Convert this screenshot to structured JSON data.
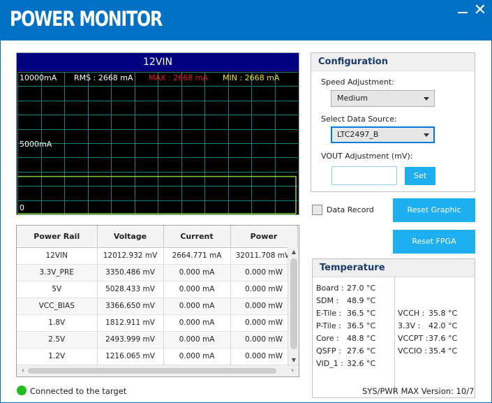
{
  "app": {
    "title": "POWER MONITOR",
    "minimize_icon": "minimize-icon",
    "close_icon": "close-icon",
    "close_glyph": "✕"
  },
  "graph": {
    "rail": "12VIN",
    "y_max_label": "10000mA",
    "y_mid_label": "5000mA",
    "y_min_label": "0",
    "rms": "RMS : 2668 mA",
    "max": "MAX : 2668 mA",
    "min": "MIN : 2668 mA",
    "colors": {
      "header_bg": "#000080",
      "grid": "#1a7f7f",
      "trace": "#7fd13b",
      "max": "#e02020",
      "min": "#f0e020"
    }
  },
  "chart_data": {
    "type": "line",
    "title": "12VIN",
    "ylim": [
      0,
      10000
    ],
    "ytick_labels": [
      "10000mA",
      "5000mA",
      "0"
    ],
    "series": [
      {
        "name": "12VIN",
        "values": [
          2668,
          2668
        ]
      }
    ],
    "stats": {
      "rms_ma": 2668,
      "max_ma": 2668,
      "min_ma": 2668
    },
    "grid": true
  },
  "table": {
    "headers": [
      "Power Rail",
      "Voltage",
      "Current",
      "Power"
    ],
    "rows": [
      [
        "12VIN",
        "12012.932 mV",
        "2664.771 mA",
        "32011.708 mW"
      ],
      [
        "3.3V_PRE",
        "3350.486 mV",
        "0.000 mA",
        "0.000 mW"
      ],
      [
        "5V",
        "5028.433 mV",
        "0.000 mA",
        "0.000 mW"
      ],
      [
        "VCC_BIAS",
        "3366.650 mV",
        "0.000 mA",
        "0.000 mW"
      ],
      [
        "1.8V",
        "1812.911 mV",
        "0.000 mA",
        "0.000 mW"
      ],
      [
        "2.5V",
        "2493.999 mV",
        "0.000 mA",
        "0.000 mW"
      ],
      [
        "1.2V",
        "1216.065 mV",
        "0.000 mA",
        "0.000 mW"
      ]
    ]
  },
  "config": {
    "title": "Configuration",
    "speed_label": "Speed Adjustment:",
    "speed_value": "Medium",
    "source_label": "Select Data Source:",
    "source_value": "LTC2497_B",
    "vout_label": "VOUT Adjustment (mV):",
    "vout_value": "",
    "set_label": "Set"
  },
  "controls": {
    "data_record_label": "Data Record",
    "data_record_checked": false,
    "reset_graphic_label": "Reset Graphic",
    "reset_fpga_label": "Reset FPGA"
  },
  "temperature": {
    "title": "Temperature",
    "left": [
      {
        "name": "Board :",
        "value": "27.0 °C"
      },
      {
        "name": "SDM :",
        "value": "48.9 °C"
      },
      {
        "name": "E-Tile :",
        "value": "36.5 °C"
      },
      {
        "name": "P-Tile :",
        "value": "36.5 °C"
      },
      {
        "name": "Core :",
        "value": "48.8 °C"
      },
      {
        "name": "QSFP :",
        "value": "27.6 °C"
      },
      {
        "name": "VID_1 :",
        "value": "32.6 °C"
      }
    ],
    "right": [
      {
        "name": "VCCH :",
        "value": "35.8 °C"
      },
      {
        "name": "3.3V :",
        "value": "42.0 °C"
      },
      {
        "name": "VCCPT :",
        "value": "37.6 °C"
      },
      {
        "name": "VCCIO :",
        "value": "35.4 °C"
      }
    ]
  },
  "status": {
    "connection": "Connected to the target",
    "version": "SYS/PWR MAX Version:  10/7",
    "dot_color": "#22bb22"
  }
}
